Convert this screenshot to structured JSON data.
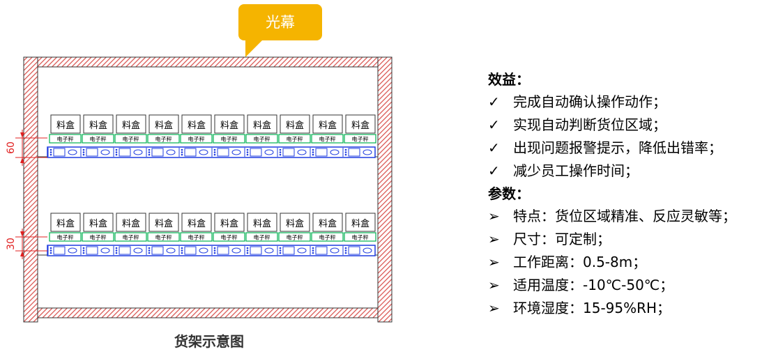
{
  "callout": {
    "label": "光幕",
    "bg_color": "#F5B400"
  },
  "caption": "货架示意图",
  "box_label": "料盒",
  "scale_label": "电子秤",
  "dimensions": {
    "upper": "60",
    "lower": "30"
  },
  "benefits": {
    "title": "效益：",
    "items": [
      "完成自动确认操作动作；",
      "实现自动判断货位区域；",
      "出现问题报警提示，降低出错率；",
      "减少员工操作时间；"
    ]
  },
  "params": {
    "title": "参数：",
    "items": [
      "特点：货位区域精准、反应灵敏等；",
      "尺寸：可定制；",
      "工作距离：0.5-8m；",
      "适用温度：-10℃-50℃；",
      "环境湿度：15-95%RH；"
    ]
  },
  "icons": {
    "check": "checkmark-icon",
    "arrow": "arrow-right-icon"
  },
  "colors": {
    "frame": "#D9534F",
    "scale": "#00B050",
    "rail": "#1F3CE0",
    "dim": "#E02020"
  }
}
